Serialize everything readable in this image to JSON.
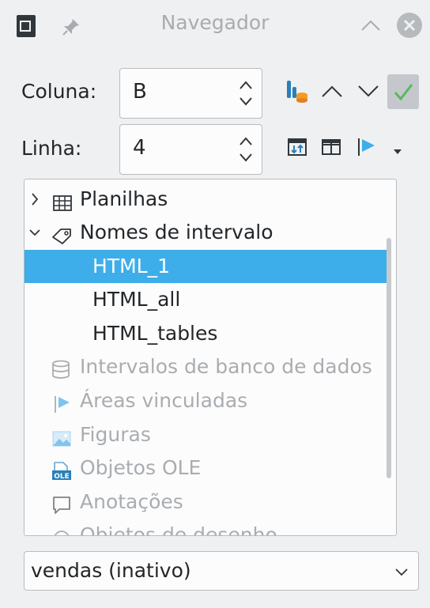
{
  "window": {
    "title": "Navegador"
  },
  "fields": {
    "column_label": "Coluna:",
    "column_value": "B",
    "row_label": "Linha:",
    "row_value": "4"
  },
  "toolbar": {
    "confirm_color": "#5cb85c",
    "icons": [
      "content-view-icon",
      "previous-icon",
      "next-icon",
      "confirm-icon",
      "toggle-icon",
      "scenarios-icon",
      "drag-mode-icon",
      "dropdown-icon"
    ]
  },
  "tree": {
    "items": [
      {
        "label": "Planilhas",
        "icon": "sheets-icon",
        "expanded": false,
        "state": "normal"
      },
      {
        "label": "Nomes de intervalo",
        "icon": "tag-icon",
        "expanded": true,
        "state": "normal"
      },
      {
        "label": "HTML_1",
        "state": "selected"
      },
      {
        "label": "HTML_all",
        "state": "normal"
      },
      {
        "label": "HTML_tables",
        "state": "normal"
      },
      {
        "label": "Intervalos de banco de dados",
        "icon": "database-icon",
        "state": "dimmed"
      },
      {
        "label": "Áreas vinculadas",
        "icon": "linked-area-icon",
        "state": "dimmed"
      },
      {
        "label": "Figuras",
        "icon": "image-icon",
        "state": "dimmed"
      },
      {
        "label": "Objetos OLE",
        "icon": "ole-object-icon",
        "state": "dimmed"
      },
      {
        "label": "Anotações",
        "icon": "comment-icon",
        "state": "dimmed"
      },
      {
        "label": "Objetos de desenho",
        "icon": "drawing-icon",
        "state": "dimmed"
      }
    ],
    "selection_color": "#3daee9"
  },
  "document_select": {
    "value": "vendas (inativo)"
  }
}
